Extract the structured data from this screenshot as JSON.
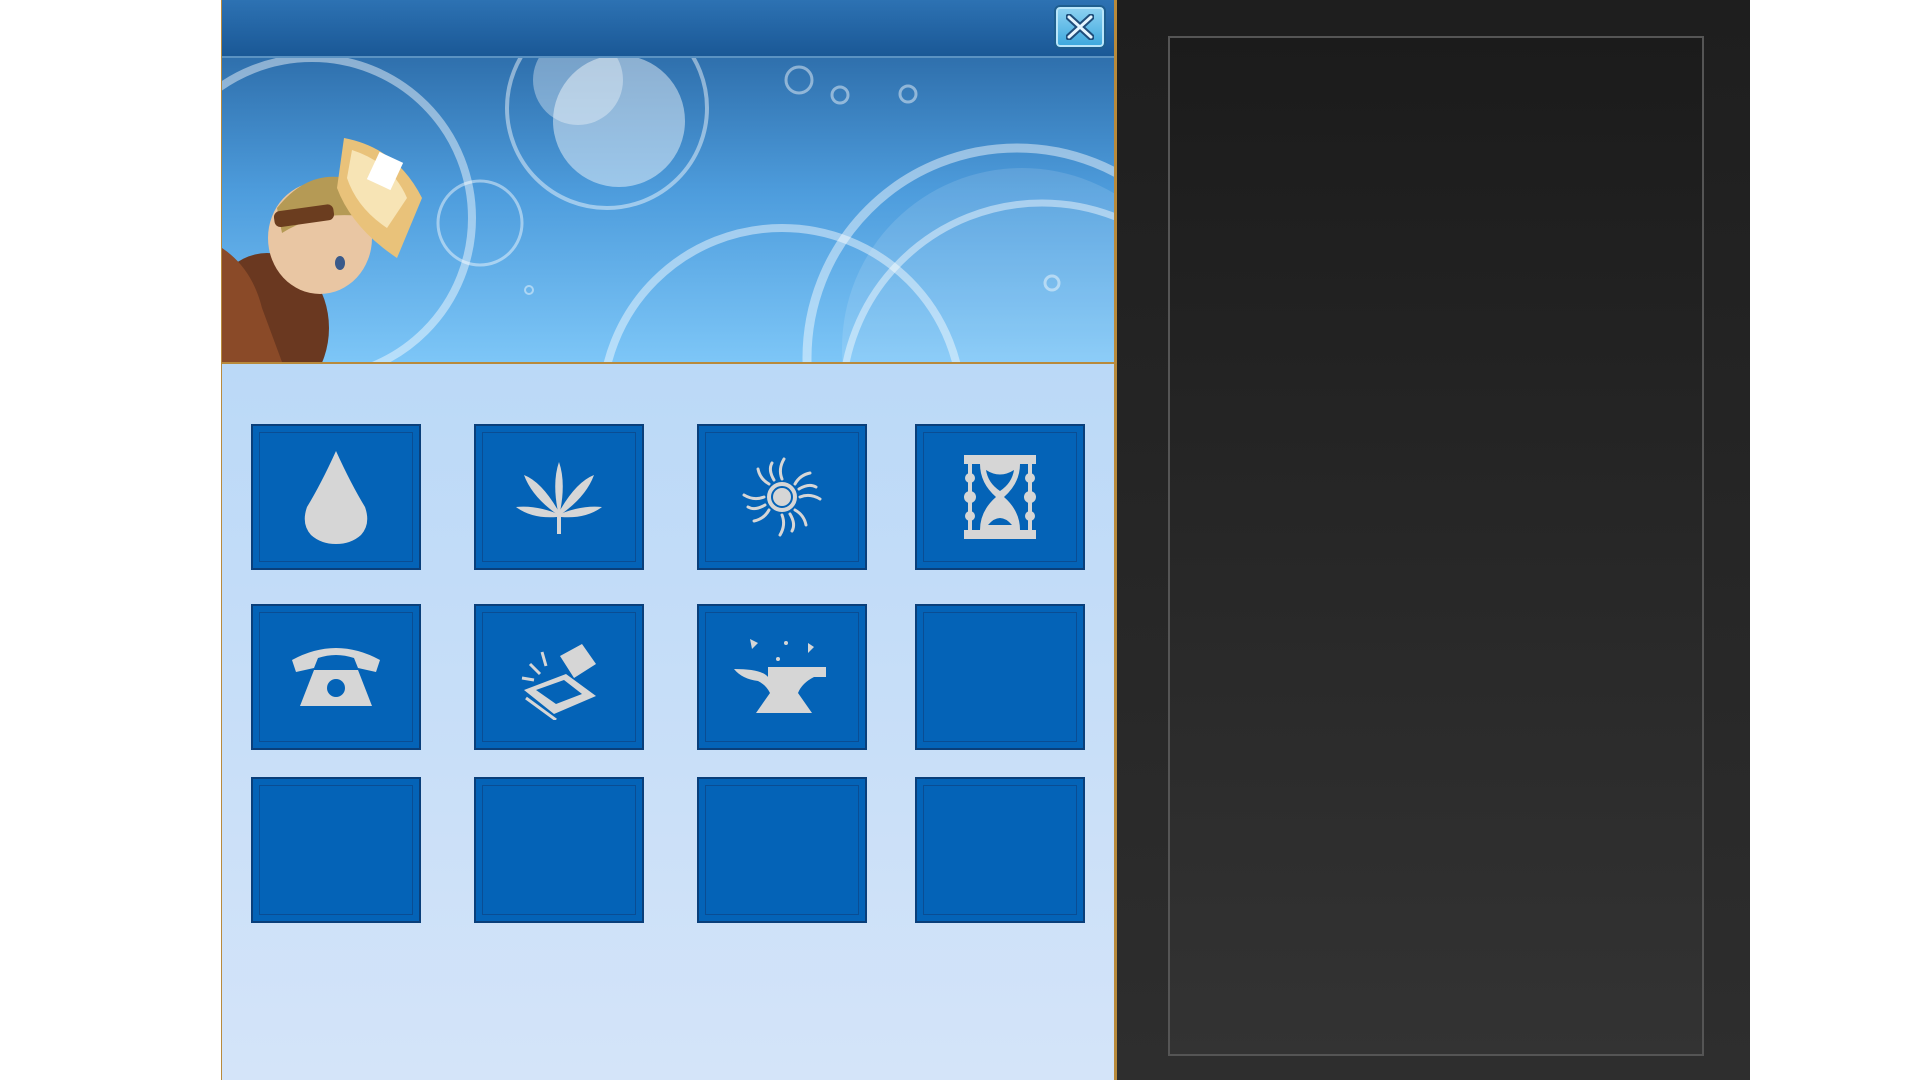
{
  "dialog": {
    "close_icon": "close-x-icon",
    "banner": {
      "character": "goggled-craftsman-character"
    }
  },
  "colors": {
    "title_bar": "#2064a3",
    "banner_top": "#2f70ad",
    "banner_bottom": "#7dc6f7",
    "panel_bg": "#c1dcf8",
    "slot_fill": "#0463b7",
    "slot_border": "#0a3f7a",
    "icon_fill": "#d6d6d6",
    "panel_border": "#b88a3c",
    "right_panel_bg": "#262626",
    "right_frame_border": "#555555"
  },
  "slots": [
    {
      "icon": "water-drop-icon"
    },
    {
      "icon": "leaf-icon"
    },
    {
      "icon": "sun-icon"
    },
    {
      "icon": "hourglass-icon"
    },
    {
      "icon": "telephone-icon"
    },
    {
      "icon": "trap-icon"
    },
    {
      "icon": "anvil-icon"
    },
    {
      "icon": null
    },
    {
      "icon": null
    },
    {
      "icon": null
    },
    {
      "icon": null
    },
    {
      "icon": null
    }
  ],
  "right_panel": {
    "content": ""
  }
}
